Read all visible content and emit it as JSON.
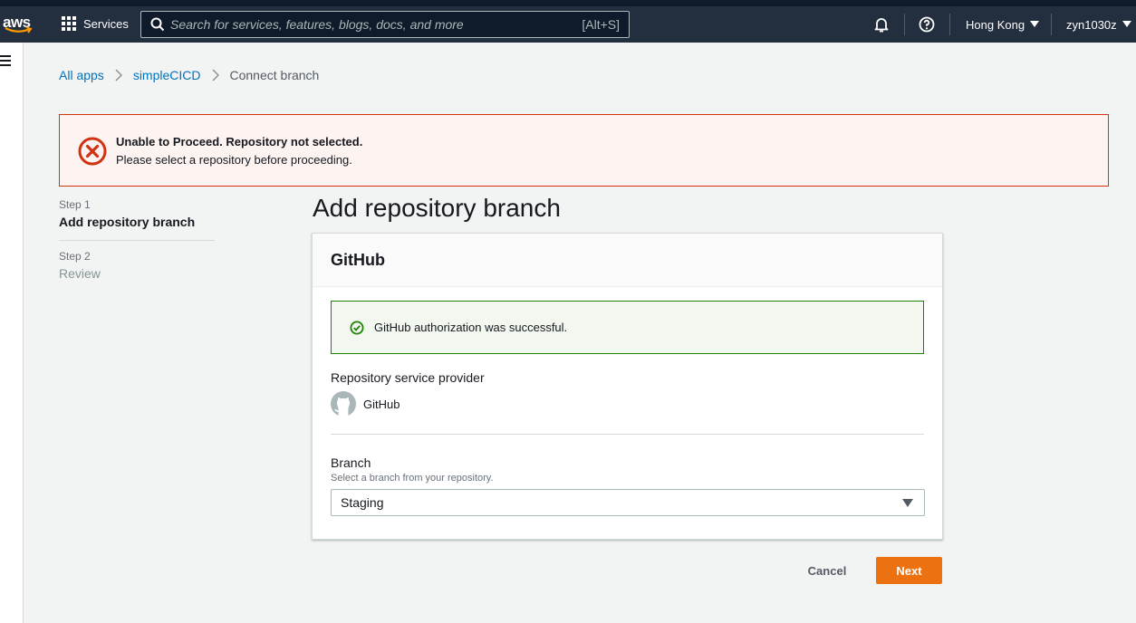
{
  "topbar": {
    "logo_text": "aws",
    "services_label": "Services",
    "search_placeholder": "Search for services, features, blogs, docs, and more",
    "search_shortcut": "[Alt+S]",
    "region": "Hong Kong",
    "user": "zyn1030z"
  },
  "breadcrumb": {
    "items": [
      "All apps",
      "simpleCICD"
    ],
    "current": "Connect branch"
  },
  "alert": {
    "title": "Unable to Proceed. Repository not selected.",
    "message": "Please select a repository before proceeding."
  },
  "steps": [
    {
      "label": "Step 1",
      "name": "Add repository branch"
    },
    {
      "label": "Step 2",
      "name": "Review"
    }
  ],
  "page_title": "Add repository branch",
  "panel": {
    "title": "GitHub",
    "success_message": "GitHub authorization was successful.",
    "provider_label": "Repository service provider",
    "provider_name": "GitHub",
    "branch_label": "Branch",
    "branch_description": "Select a branch from your repository.",
    "branch_value": "Staging"
  },
  "actions": {
    "cancel": "Cancel",
    "next": "Next"
  },
  "colors": {
    "topbar_bg": "#232f3e",
    "link": "#0073bb",
    "error": "#d13212",
    "success": "#1d8102",
    "primary_button": "#ec7211"
  }
}
